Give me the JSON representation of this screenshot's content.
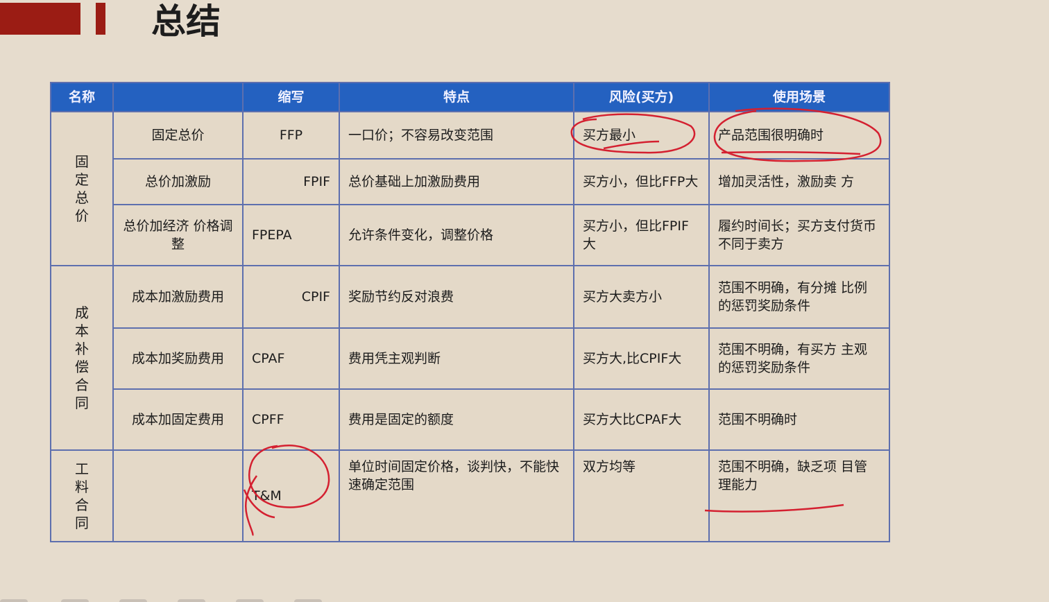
{
  "slide": {
    "title": "总结"
  },
  "table": {
    "headers": [
      "名称",
      "",
      "缩写",
      "特点",
      "风险(买方)",
      "使用场景"
    ],
    "groups": [
      {
        "label": "固定总价"
      },
      {
        "label": "成本补偿合同"
      },
      {
        "label": "工料合同"
      }
    ],
    "rows": [
      {
        "name": "固定总价",
        "abbr": "FFP",
        "feature": "一口价；不容易改变范围",
        "risk": "买方最小",
        "scenario": "产品范围很明确时"
      },
      {
        "name": "总价加激励",
        "abbr": "FPIF",
        "feature": "总价基础上加激励费用",
        "risk": "买方小，但比FFP大",
        "scenario": "增加灵活性，激励卖 方"
      },
      {
        "name": "总价加经济 价格调整",
        "abbr": "FPEPA",
        "feature": "允许条件变化，调整价格",
        "risk": "买方小，但比FPIF大",
        "scenario": "履约时间长；买方支付货币不同于卖方"
      },
      {
        "name": "成本加激励费用",
        "abbr": "CPIF",
        "feature": "奖励节约反对浪费",
        "risk": "买方大卖方小",
        "scenario": "范围不明确，有分摊 比例的惩罚奖励条件"
      },
      {
        "name": "成本加奖励费用",
        "abbr": "CPAF",
        "feature": "费用凭主观判断",
        "risk": "买方大,比CPIF大",
        "scenario": "范围不明确，有买方 主观的惩罚奖励条件"
      },
      {
        "name": "成本加固定费用",
        "abbr": "CPFF",
        "feature": "费用是固定的额度",
        "risk": "买方大比CPAF大",
        "scenario": "范围不明确时"
      },
      {
        "name": "",
        "abbr": "T&M",
        "feature": "单位时间固定价格，谈判快，不能快速确定范围",
        "risk": "双方均等",
        "scenario": "范围不明确，缺乏项 目管理能力"
      }
    ]
  },
  "colors": {
    "header_bg": "#2461c0",
    "accent": "#9b1c14",
    "ink": "#d42030",
    "background": "#e6dccd"
  }
}
